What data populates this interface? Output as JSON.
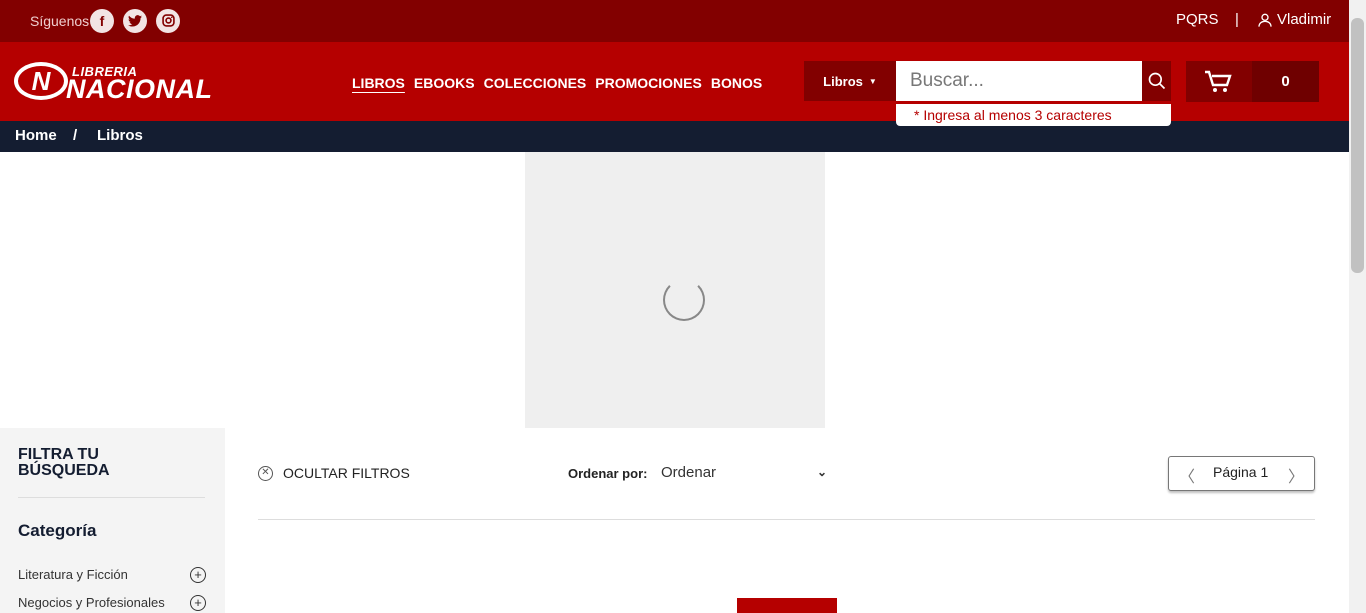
{
  "topbar": {
    "follow_label": "Síguenos",
    "social": [
      "facebook-icon",
      "twitter-icon",
      "instagram-icon"
    ],
    "pqrs": "PQRS",
    "separator": "|",
    "user": "Vladimir"
  },
  "header": {
    "logo_small": "LIBRERIA",
    "logo_big": "NACIONAL",
    "nav": [
      "LIBROS",
      "EBOOKS",
      "COLECCIONES",
      "PROMOCIONES",
      "BONOS"
    ],
    "search_category": "Libros",
    "search_placeholder": "Buscar...",
    "search_hint": "* Ingresa al menos 3 caracteres",
    "cart_count": "0"
  },
  "breadcrumb": {
    "home": "Home",
    "separator": "/",
    "current": "Libros"
  },
  "sidebar": {
    "title": "FILTRA TU BÚSQUEDA",
    "category_title": "Categoría",
    "items": [
      "Literatura y Ficción",
      "Negocios y Profesionales"
    ]
  },
  "toolbar": {
    "hide_filters": "OCULTAR FILTROS",
    "order_label": "Ordenar por:",
    "order_value": "Ordenar",
    "page_label": "Página 1"
  },
  "colors": {
    "topbar": "#820000",
    "header": "#b50000",
    "breadcrumb": "#141d31"
  }
}
